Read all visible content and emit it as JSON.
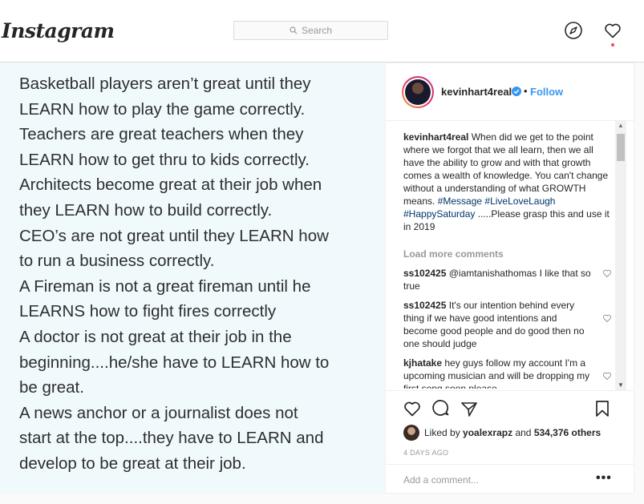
{
  "nav": {
    "logo": "Instagram",
    "search_placeholder": "Search",
    "icons": [
      "search-icon",
      "explore-compass-icon",
      "activity-heart-icon"
    ]
  },
  "post_image": {
    "lines": [
      "Basketball players aren’t great until they",
      "LEARN how to play the game correctly.",
      "Teachers are great teachers when they",
      "LEARN how to get thru to kids correctly.",
      "Architects become great at their job when",
      "they LEARN how to build correctly.",
      "CEO’s are not great until they LEARN how",
      "to run a business correctly.",
      "A Fireman is not a great fireman until he",
      "LEARNS how to fight fires correctly",
      "A doctor is not great at their job in the",
      "beginning....he/she have to LEARN how to",
      "be great.",
      "A news anchor or a journalist does not",
      "start at the top....they have to LEARN and",
      "develop to be great at their job."
    ]
  },
  "header": {
    "username": "kevinhart4real",
    "separator": "•",
    "follow_label": "Follow"
  },
  "caption": {
    "username": "kevinhart4real",
    "text": "When did we get to the point where we forgot that we all learn, then we all have the ability to grow and with that growth comes a wealth of knowledge. You can't change without a understanding of what GROWTH means.",
    "tags": "#Message #LiveLoveLaugh #HappySaturday",
    "text_after": ".....Please grasp this and use it in 2019"
  },
  "load_more": "Load more comments",
  "comments": [
    {
      "user": "ss102425",
      "text": "@iamtanishathomas I like that so true"
    },
    {
      "user": "ss102425",
      "text": "It's our intention behind every thing if we have good intentions and become good people and do good then no one should judge"
    },
    {
      "user": "kjhatake",
      "text": "hey guys follow my account I'm a upcoming musician and will be dropping my first song soon please"
    }
  ],
  "likes": {
    "prefix": "Liked by",
    "user": "yoalexrapz",
    "middle": "and",
    "count": "534,376 others"
  },
  "age": "4 DAYS AGO",
  "add_comment_placeholder": "Add a comment...",
  "more_label": "•••",
  "colors": {
    "link_blue": "#3897f0",
    "hashtag": "#003569",
    "image_bg": "#f0fafd",
    "notif_dot": "#ed4956"
  }
}
